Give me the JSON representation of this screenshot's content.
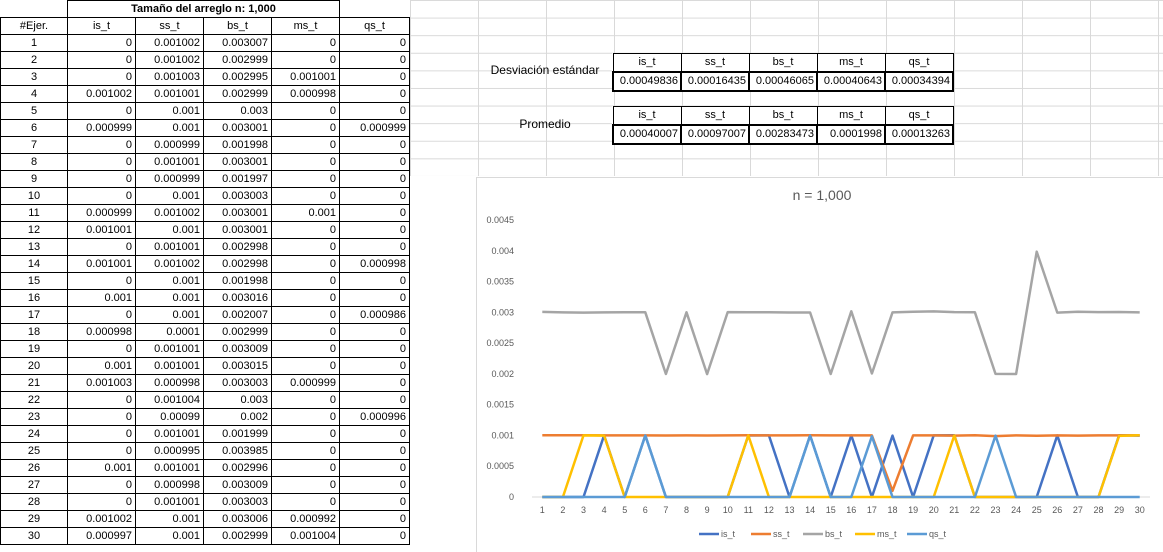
{
  "data_table": {
    "title": "Tamaño del arreglo n: 1,000",
    "headers": [
      "#Ejer.",
      "is_t",
      "ss_t",
      "bs_t",
      "ms_t",
      "qs_t"
    ],
    "rows": [
      [
        "1",
        "0",
        "0.001002",
        "0.003007",
        "0",
        "0"
      ],
      [
        "2",
        "0",
        "0.001002",
        "0.002999",
        "0",
        "0"
      ],
      [
        "3",
        "0",
        "0.001003",
        "0.002995",
        "0.001001",
        "0"
      ],
      [
        "4",
        "0.001002",
        "0.001001",
        "0.002999",
        "0.000998",
        "0"
      ],
      [
        "5",
        "0",
        "0.001",
        "0.003",
        "0",
        "0"
      ],
      [
        "6",
        "0.000999",
        "0.001",
        "0.003001",
        "0",
        "0.000999"
      ],
      [
        "7",
        "0",
        "0.000999",
        "0.001998",
        "0",
        "0"
      ],
      [
        "8",
        "0",
        "0.001001",
        "0.003001",
        "0",
        "0"
      ],
      [
        "9",
        "0",
        "0.000999",
        "0.001997",
        "0",
        "0"
      ],
      [
        "10",
        "0",
        "0.001",
        "0.003003",
        "0",
        "0"
      ],
      [
        "11",
        "0.000999",
        "0.001002",
        "0.003001",
        "0.001",
        "0"
      ],
      [
        "12",
        "0.001001",
        "0.001",
        "0.003001",
        "0",
        "0"
      ],
      [
        "13",
        "0",
        "0.001001",
        "0.002998",
        "0",
        "0"
      ],
      [
        "14",
        "0.001001",
        "0.001002",
        "0.002998",
        "0",
        "0.000998"
      ],
      [
        "15",
        "0",
        "0.001",
        "0.001998",
        "0",
        "0"
      ],
      [
        "16",
        "0.001",
        "0.001",
        "0.003016",
        "0",
        "0"
      ],
      [
        "17",
        "0",
        "0.001",
        "0.002007",
        "0",
        "0.000986"
      ],
      [
        "18",
        "0.000998",
        "0.0001",
        "0.002999",
        "0",
        "0"
      ],
      [
        "19",
        "0",
        "0.001001",
        "0.003009",
        "0",
        "0"
      ],
      [
        "20",
        "0.001",
        "0.001001",
        "0.003015",
        "0",
        "0"
      ],
      [
        "21",
        "0.001003",
        "0.000998",
        "0.003003",
        "0.000999",
        "0"
      ],
      [
        "22",
        "0",
        "0.001004",
        "0.003",
        "0",
        "0"
      ],
      [
        "23",
        "0",
        "0.00099",
        "0.002",
        "0",
        "0.000996"
      ],
      [
        "24",
        "0",
        "0.001001",
        "0.001999",
        "0",
        "0"
      ],
      [
        "25",
        "0",
        "0.000995",
        "0.003985",
        "0",
        "0"
      ],
      [
        "26",
        "0.001",
        "0.001001",
        "0.002996",
        "0",
        "0"
      ],
      [
        "27",
        "0",
        "0.000998",
        "0.003009",
        "0",
        "0"
      ],
      [
        "28",
        "0",
        "0.001001",
        "0.003003",
        "0",
        "0"
      ],
      [
        "29",
        "0.001002",
        "0.001",
        "0.003006",
        "0.000992",
        "0"
      ],
      [
        "30",
        "0.000997",
        "0.001",
        "0.002999",
        "0.001004",
        "0"
      ]
    ]
  },
  "stats": {
    "desviacion": {
      "label": "Desviación estándar",
      "headers": [
        "is_t",
        "ss_t",
        "bs_t",
        "ms_t",
        "qs_t"
      ],
      "values": [
        "0.00049836",
        "0.00016435",
        "0.00046065",
        "0.00040643",
        "0.00034394"
      ]
    },
    "promedio": {
      "label": "Promedio",
      "headers": [
        "is_t",
        "ss_t",
        "bs_t",
        "ms_t",
        "qs_t"
      ],
      "values": [
        "0.00040007",
        "0.00097007",
        "0.00283473",
        "0.0001998",
        "0.00013263"
      ]
    }
  },
  "chart_data": {
    "type": "line",
    "title": "n = 1,000",
    "x": [
      1,
      2,
      3,
      4,
      5,
      6,
      7,
      8,
      9,
      10,
      11,
      12,
      13,
      14,
      15,
      16,
      17,
      18,
      19,
      20,
      21,
      22,
      23,
      24,
      25,
      26,
      27,
      28,
      29,
      30
    ],
    "ylim": [
      0,
      0.0045
    ],
    "y_ticks": [
      "0",
      "0.0005",
      "0.001",
      "0.0015",
      "0.002",
      "0.0025",
      "0.003",
      "0.0035",
      "0.004",
      "0.0045"
    ],
    "legend_position": "bottom",
    "grid": false,
    "series": [
      {
        "name": "is_t",
        "color": "#4472C4",
        "values": [
          0,
          0,
          0,
          0.001002,
          0,
          0.000999,
          0,
          0,
          0,
          0,
          0.000999,
          0.001001,
          0,
          0.001001,
          0,
          0.001,
          0,
          0.000998,
          0,
          0.001,
          0.001003,
          0,
          0,
          0,
          0,
          0.001,
          0,
          0,
          0.001002,
          0.000997
        ]
      },
      {
        "name": "ss_t",
        "color": "#ED7D31",
        "values": [
          0.001002,
          0.001002,
          0.001003,
          0.001001,
          0.001,
          0.001,
          0.000999,
          0.001001,
          0.000999,
          0.001,
          0.001002,
          0.001,
          0.001001,
          0.001002,
          0.001,
          0.001,
          0.001,
          0.0001,
          0.001001,
          0.001001,
          0.000998,
          0.001004,
          0.00099,
          0.001001,
          0.000995,
          0.001001,
          0.000998,
          0.001001,
          0.001,
          0.001
        ]
      },
      {
        "name": "bs_t",
        "color": "#A5A5A5",
        "values": [
          0.003007,
          0.002999,
          0.002995,
          0.002999,
          0.003,
          0.003001,
          0.001998,
          0.003001,
          0.001997,
          0.003003,
          0.003001,
          0.003001,
          0.002998,
          0.002998,
          0.001998,
          0.003016,
          0.002007,
          0.002999,
          0.003009,
          0.003015,
          0.003003,
          0.003,
          0.002,
          0.001999,
          0.003985,
          0.002996,
          0.003009,
          0.003003,
          0.003006,
          0.002999
        ]
      },
      {
        "name": "ms_t",
        "color": "#FFC000",
        "values": [
          0,
          0,
          0.001001,
          0.000998,
          0,
          0,
          0,
          0,
          0,
          0,
          0.001,
          0,
          0,
          0,
          0,
          0,
          0,
          0,
          0,
          0,
          0.000999,
          0,
          0,
          0,
          0,
          0,
          0,
          0,
          0.000992,
          0.001004
        ]
      },
      {
        "name": "qs_t",
        "color": "#5B9BD5",
        "values": [
          0,
          0,
          0,
          0,
          0,
          0.000999,
          0,
          0,
          0,
          0,
          0,
          0,
          0,
          0.000998,
          0,
          0,
          0.000986,
          0,
          0,
          0,
          0,
          0,
          0.000996,
          0,
          0,
          0,
          0,
          0,
          0,
          0
        ]
      }
    ]
  }
}
